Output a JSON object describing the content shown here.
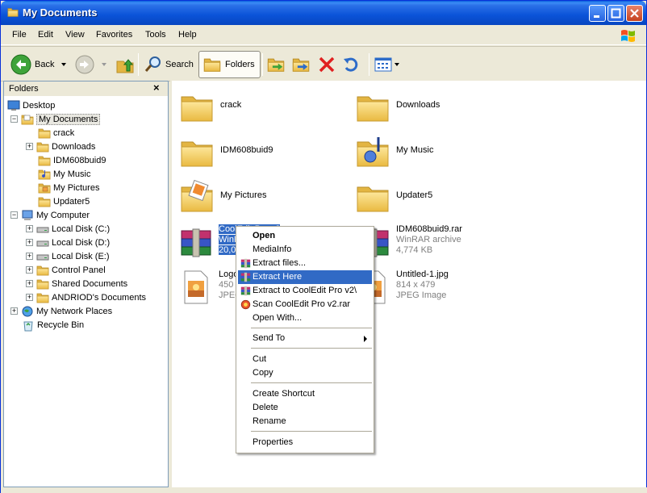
{
  "window": {
    "title": "My Documents"
  },
  "menu": [
    "File",
    "Edit",
    "View",
    "Favorites",
    "Tools",
    "Help"
  ],
  "toolbar": {
    "back": "Back",
    "search": "Search",
    "folders": "Folders"
  },
  "folders_pane": {
    "title": "Folders",
    "close": "×",
    "tree": [
      {
        "label": "Desktop"
      },
      {
        "label": "My Documents"
      },
      {
        "label": "crack"
      },
      {
        "label": "Downloads"
      },
      {
        "label": "IDM608buid9"
      },
      {
        "label": "My Music"
      },
      {
        "label": "My Pictures"
      },
      {
        "label": "Updater5"
      },
      {
        "label": "My Computer"
      },
      {
        "label": "Local Disk (C:)"
      },
      {
        "label": "Local Disk (D:)"
      },
      {
        "label": "Local Disk (E:)"
      },
      {
        "label": "Control Panel"
      },
      {
        "label": "Shared Documents"
      },
      {
        "label": "ANDRIOD's Documents"
      },
      {
        "label": "My Network Places"
      },
      {
        "label": "Recycle Bin"
      }
    ]
  },
  "content": {
    "items": [
      {
        "name": "crack"
      },
      {
        "name": "Downloads"
      },
      {
        "name": "IDM608buid9"
      },
      {
        "name": "My Music"
      },
      {
        "name": "My Pictures"
      },
      {
        "name": "Updater5"
      },
      {
        "name": "CoolEdit Pro v2",
        "line2": "WinRAR",
        "line3": "20,0"
      },
      {
        "name": "IDM608buid9.rar",
        "line2": "WinRAR archive",
        "line3": "4,774 KB"
      },
      {
        "name": "Logo-",
        "line2": "450 x",
        "line3": "JPEG"
      },
      {
        "name": "Untitled-1.jpg",
        "line2": "814 x 479",
        "line3": "JPEG Image"
      }
    ]
  },
  "context_menu": {
    "open": "Open",
    "mediainfo": "MediaInfo",
    "extract_files": "Extract files...",
    "extract_here": "Extract Here",
    "extract_to": "Extract to CoolEdit Pro v2\\",
    "scan": "Scan CoolEdit Pro v2.rar",
    "open_with": "Open With...",
    "send_to": "Send To",
    "cut": "Cut",
    "copy": "Copy",
    "create_shortcut": "Create Shortcut",
    "delete": "Delete",
    "rename": "Rename",
    "properties": "Properties"
  },
  "colors": {
    "selection": "#316ac5",
    "titlebar": "#0a53d8",
    "folder": "#f7d36b"
  }
}
